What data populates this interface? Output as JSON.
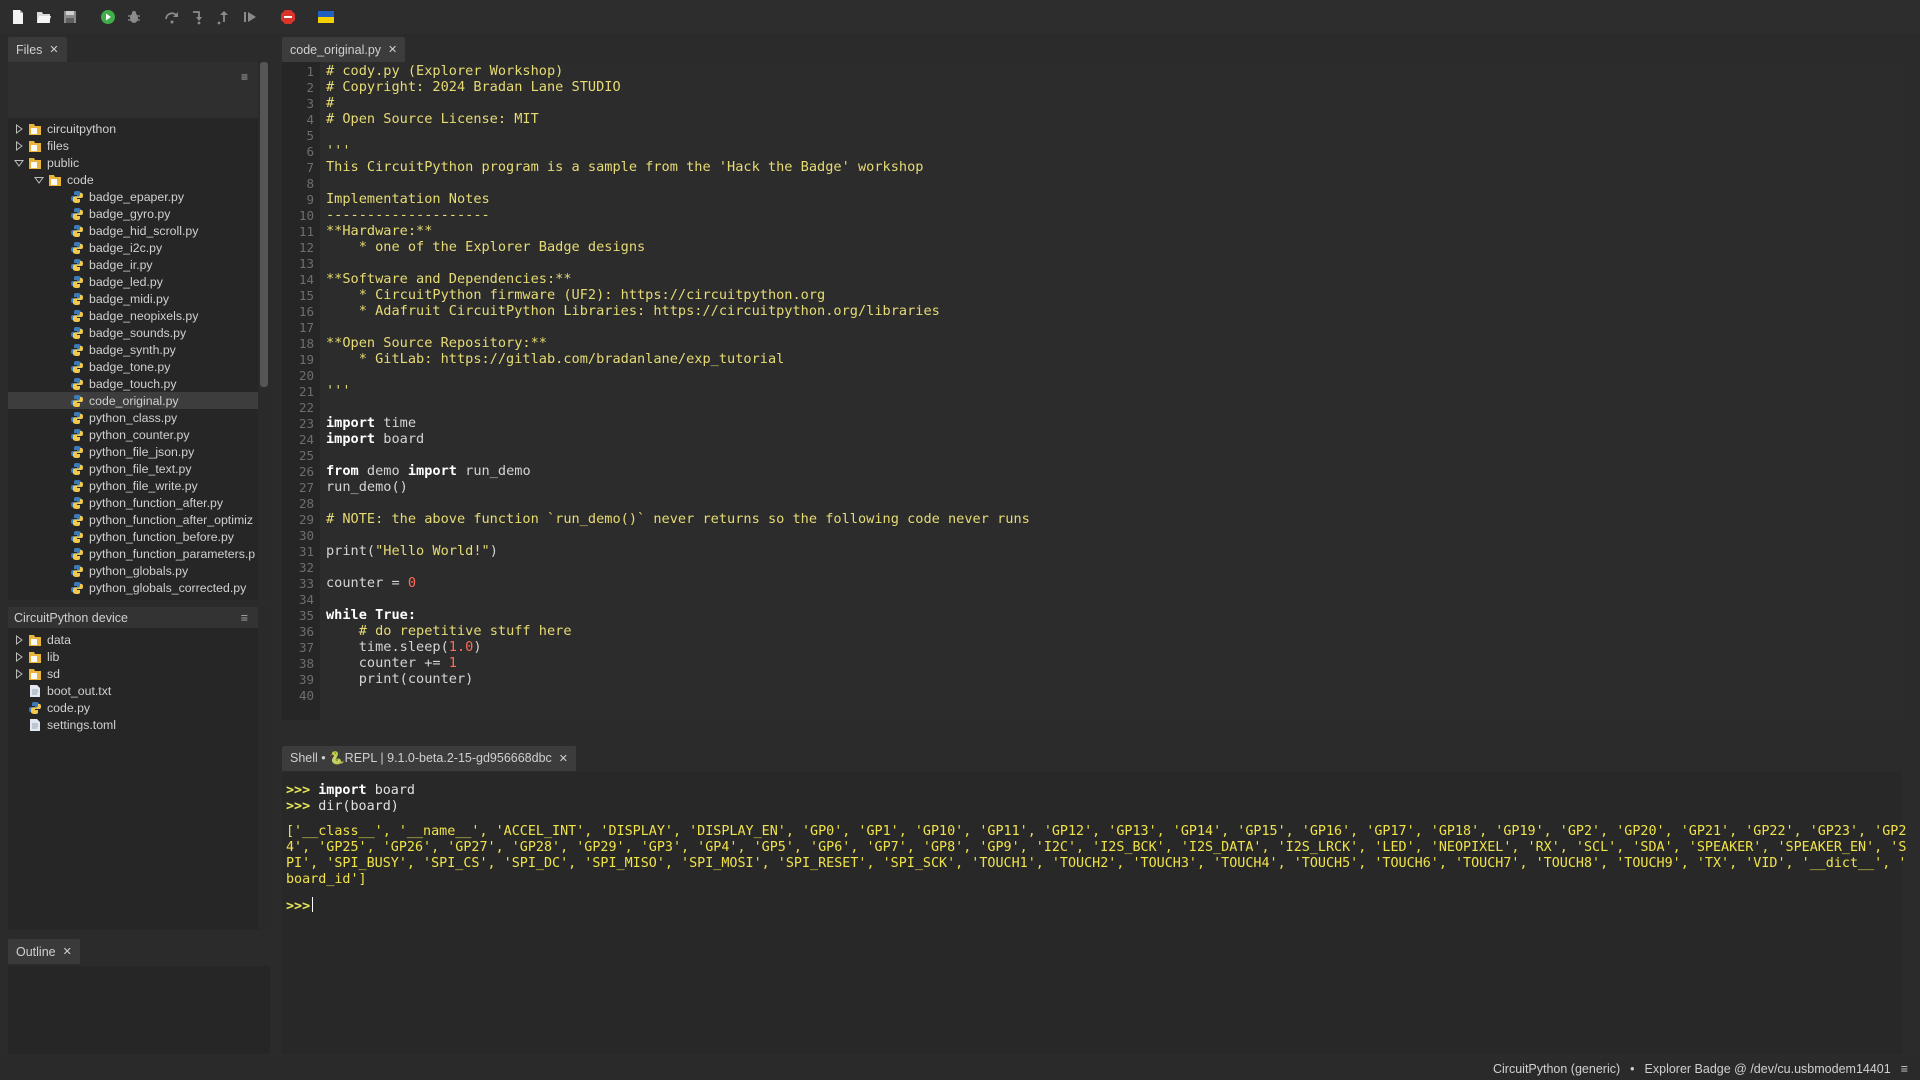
{
  "toolbar": {
    "buttons": [
      "new-file",
      "open-file",
      "save-file",
      "run",
      "debug",
      "step-over",
      "step-into",
      "step-out",
      "resume",
      "stop",
      "ukraine-flag"
    ]
  },
  "files_panel": {
    "tab_label": "Files",
    "close_glyph": "✕",
    "menu_glyph": "≡",
    "items": [
      {
        "label": "circuitpython",
        "type": "folder",
        "depth": 0,
        "state": "collapsed"
      },
      {
        "label": "files",
        "type": "folder",
        "depth": 0,
        "state": "collapsed"
      },
      {
        "label": "public",
        "type": "folder",
        "depth": 0,
        "state": "expanded"
      },
      {
        "label": "code",
        "type": "folder",
        "depth": 1,
        "state": "expanded"
      },
      {
        "label": "badge_epaper.py",
        "type": "python",
        "depth": 2
      },
      {
        "label": "badge_gyro.py",
        "type": "python",
        "depth": 2
      },
      {
        "label": "badge_hid_scroll.py",
        "type": "python",
        "depth": 2
      },
      {
        "label": "badge_i2c.py",
        "type": "python",
        "depth": 2
      },
      {
        "label": "badge_ir.py",
        "type": "python",
        "depth": 2
      },
      {
        "label": "badge_led.py",
        "type": "python",
        "depth": 2
      },
      {
        "label": "badge_midi.py",
        "type": "python",
        "depth": 2
      },
      {
        "label": "badge_neopixels.py",
        "type": "python",
        "depth": 2
      },
      {
        "label": "badge_sounds.py",
        "type": "python",
        "depth": 2
      },
      {
        "label": "badge_synth.py",
        "type": "python",
        "depth": 2
      },
      {
        "label": "badge_tone.py",
        "type": "python",
        "depth": 2
      },
      {
        "label": "badge_touch.py",
        "type": "python",
        "depth": 2
      },
      {
        "label": "code_original.py",
        "type": "python",
        "depth": 2,
        "selected": true
      },
      {
        "label": "python_class.py",
        "type": "python",
        "depth": 2
      },
      {
        "label": "python_counter.py",
        "type": "python",
        "depth": 2
      },
      {
        "label": "python_file_json.py",
        "type": "python",
        "depth": 2
      },
      {
        "label": "python_file_text.py",
        "type": "python",
        "depth": 2
      },
      {
        "label": "python_file_write.py",
        "type": "python",
        "depth": 2
      },
      {
        "label": "python_function_after.py",
        "type": "python",
        "depth": 2
      },
      {
        "label": "python_function_after_optimiz",
        "type": "python",
        "depth": 2
      },
      {
        "label": "python_function_before.py",
        "type": "python",
        "depth": 2
      },
      {
        "label": "python_function_parameters.p",
        "type": "python",
        "depth": 2
      },
      {
        "label": "python_globals.py",
        "type": "python",
        "depth": 2
      },
      {
        "label": "python_globals_corrected.py",
        "type": "python",
        "depth": 2
      }
    ]
  },
  "device_panel": {
    "title": "CircuitPython device",
    "menu_glyph": "≡",
    "items": [
      {
        "label": "data",
        "type": "folder",
        "state": "collapsed"
      },
      {
        "label": "lib",
        "type": "folder",
        "state": "collapsed"
      },
      {
        "label": "sd",
        "type": "folder",
        "state": "collapsed"
      },
      {
        "label": "boot_out.txt",
        "type": "text"
      },
      {
        "label": "code.py",
        "type": "python"
      },
      {
        "label": "settings.toml",
        "type": "text"
      }
    ]
  },
  "outline_panel": {
    "tab_label": "Outline",
    "close_glyph": "✕"
  },
  "editor": {
    "tab_label": "code_original.py",
    "close_glyph": "✕",
    "lines": [
      [
        [
          "# cody.py (Explorer Workshop)",
          "y"
        ]
      ],
      [
        [
          "# Copyright: 2024 Bradan Lane STUDIO",
          "y"
        ]
      ],
      [
        [
          "#",
          "y"
        ]
      ],
      [
        [
          "# Open Source License: MIT",
          "y"
        ]
      ],
      [],
      [
        [
          "'''",
          "y"
        ]
      ],
      [
        [
          "This CircuitPython program is a sample from the 'Hack the Badge' workshop",
          "y"
        ]
      ],
      [],
      [
        [
          "Implementation Notes",
          "y"
        ]
      ],
      [
        [
          "--------------------",
          "y"
        ]
      ],
      [
        [
          "**Hardware:**",
          "y"
        ]
      ],
      [
        [
          "    * one of the Explorer Badge designs",
          "y"
        ]
      ],
      [],
      [
        [
          "**Software and Dependencies:**",
          "y"
        ]
      ],
      [
        [
          "    * CircuitPython firmware (UF2): https://circuitpython.org",
          "y"
        ]
      ],
      [
        [
          "    * Adafruit CircuitPython Libraries: https://circuitpython.org/libraries",
          "y"
        ]
      ],
      [],
      [
        [
          "**Open Source Repository:**",
          "y"
        ]
      ],
      [
        [
          "    * GitLab: https://gitlab.com/bradanlane/exp_tutorial",
          "y"
        ]
      ],
      [],
      [
        [
          "'''",
          "y"
        ]
      ],
      [],
      [
        [
          "import",
          "kw"
        ],
        [
          " time",
          "n"
        ]
      ],
      [
        [
          "import",
          "kw"
        ],
        [
          " board",
          "n"
        ]
      ],
      [],
      [
        [
          "from",
          "kw"
        ],
        [
          " demo ",
          "n"
        ],
        [
          "import",
          "kw"
        ],
        [
          " run_demo",
          "n"
        ]
      ],
      [
        [
          "run_demo()",
          "n"
        ]
      ],
      [],
      [
        [
          "# NOTE: the above function `run_demo()` never returns so the following code never runs",
          "y"
        ]
      ],
      [],
      [
        [
          "print(",
          "n"
        ],
        [
          "\"Hello World!\"",
          "y"
        ],
        [
          ")",
          "n"
        ]
      ],
      [],
      [
        [
          "counter = ",
          "n"
        ],
        [
          "0",
          "num"
        ]
      ],
      [],
      [
        [
          "while",
          "kw"
        ],
        [
          " ",
          "n"
        ],
        [
          "True",
          "kw"
        ],
        [
          ":",
          "kw"
        ]
      ],
      [
        [
          "    ",
          "n"
        ],
        [
          "# do repetitive stuff here",
          "y"
        ]
      ],
      [
        [
          "    time.sleep(",
          "n"
        ],
        [
          "1.0",
          "num"
        ],
        [
          ")",
          "n"
        ]
      ],
      [
        [
          "    counter += ",
          "n"
        ],
        [
          "1",
          "num"
        ]
      ],
      [
        [
          "    print(counter)",
          "n"
        ]
      ],
      []
    ]
  },
  "shell": {
    "tab_label": "Shell • 🐍REPL | 9.1.0-beta.2-15-gd956668dbc",
    "close_glyph": "✕",
    "prompt": ">>>",
    "commands": [
      "import board",
      "dir(board)"
    ],
    "command_keywords": [
      "import"
    ],
    "output_lines": [
      "['__class__', '__name__', 'ACCEL_INT', 'DISPLAY', 'DISPLAY_EN', 'GP0', 'GP1', 'GP10', 'GP11', 'GP12', 'GP13', 'GP14', 'GP15', 'GP16', 'GP17', 'GP18', 'GP19', 'GP2', 'GP20', 'GP21', 'GP22', 'GP23', 'GP2",
      "4', 'GP25', 'GP26', 'GP27', 'GP28', 'GP29', 'GP3', 'GP4', 'GP5', 'GP6', 'GP7', 'GP8', 'GP9', 'I2C', 'I2S_BCK', 'I2S_DATA', 'I2S_LRCK', 'LED', 'NEOPIXEL', 'RX', 'SCL', 'SDA', 'SPEAKER', 'SPEAKER_EN', 'S",
      "PI', 'SPI_BUSY', 'SPI_CS', 'SPI_DC', 'SPI_MISO', 'SPI_MOSI', 'SPI_RESET', 'SPI_SCK', 'TOUCH1', 'TOUCH2', 'TOUCH3', 'TOUCH4', 'TOUCH5', 'TOUCH6', 'TOUCH7', 'TOUCH8', 'TOUCH9', 'TX', 'VID', '__dict__', '",
      "board_id']"
    ]
  },
  "statusbar": {
    "interpreter": "CircuitPython (generic)",
    "separator": "•",
    "device": "Explorer Badge @ /dev/cu.usbmodem14401",
    "menu_glyph": "≡"
  },
  "colors": {
    "background": "#2b2b2b",
    "comment_yellow": "#e6db74",
    "number_red": "#ff6b5b",
    "shell_output": "#f0e24a",
    "folder_yellow": "#e8b53a",
    "python_blue": "#3d7ab8"
  }
}
